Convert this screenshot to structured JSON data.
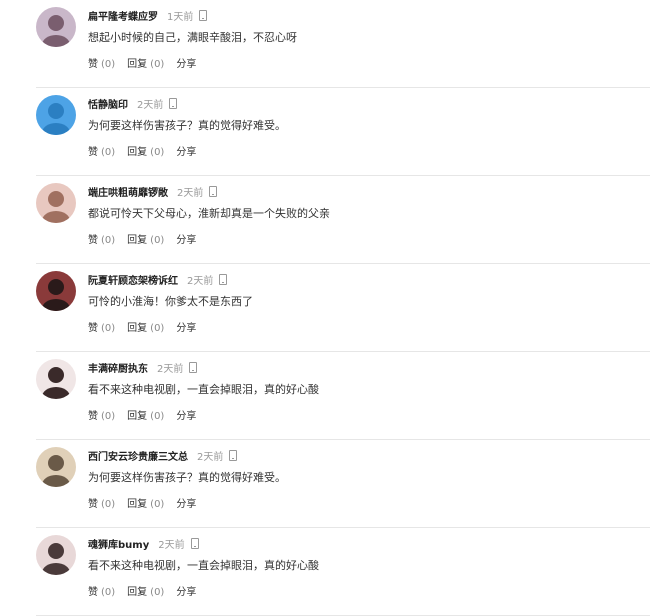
{
  "actions": {
    "like_label": "赞",
    "reply_label": "回复",
    "share_label": "分享"
  },
  "comments": [
    {
      "username": "扁平隆考蝶应罗",
      "time": "1天前",
      "text": "想起小时候的自己，满眼辛酸泪，不忍心呀",
      "like_count": "(0)",
      "reply_count": "(0)",
      "avatar_colors": [
        "#c9b7c9",
        "#7a5e6f"
      ]
    },
    {
      "username": "恬静脑印",
      "time": "2天前",
      "text": "为何要这样伤害孩子？真的觉得好难受。",
      "like_count": "(0)",
      "reply_count": "(0)",
      "avatar_colors": [
        "#4da3e6",
        "#2b7fc2"
      ]
    },
    {
      "username": "端庄哄粗萌靡锣敞",
      "time": "2天前",
      "text": "都说可怜天下父母心，淮新却真是一个失败的父亲",
      "like_count": "(0)",
      "reply_count": "(0)",
      "avatar_colors": [
        "#e8c8c0",
        "#a07060"
      ]
    },
    {
      "username": "阮夏轩顾恋架榜诉红",
      "time": "2天前",
      "text": "可怜的小淮海！你爹太不是东西了",
      "like_count": "(0)",
      "reply_count": "(0)",
      "avatar_colors": [
        "#8a3a3a",
        "#2a1a1a"
      ]
    },
    {
      "username": "丰满碎厨执东",
      "time": "2天前",
      "text": "看不来这种电视剧，一直会掉眼泪，真的好心酸",
      "like_count": "(0)",
      "reply_count": "(0)",
      "avatar_colors": [
        "#f0e6e6",
        "#3a2a2a"
      ]
    },
    {
      "username": "西门安云珍贵廉三文总",
      "time": "2天前",
      "text": "为何要这样伤害孩子？真的觉得好难受。",
      "like_count": "(0)",
      "reply_count": "(0)",
      "avatar_colors": [
        "#e0d0b8",
        "#6a5a48"
      ]
    },
    {
      "username": "魂狮库bumy",
      "time": "2天前",
      "text": "看不来这种电视剧，一直会掉眼泪，真的好心酸",
      "like_count": "(0)",
      "reply_count": "(0)",
      "avatar_colors": [
        "#e8d8d8",
        "#4a3a3a"
      ]
    }
  ]
}
